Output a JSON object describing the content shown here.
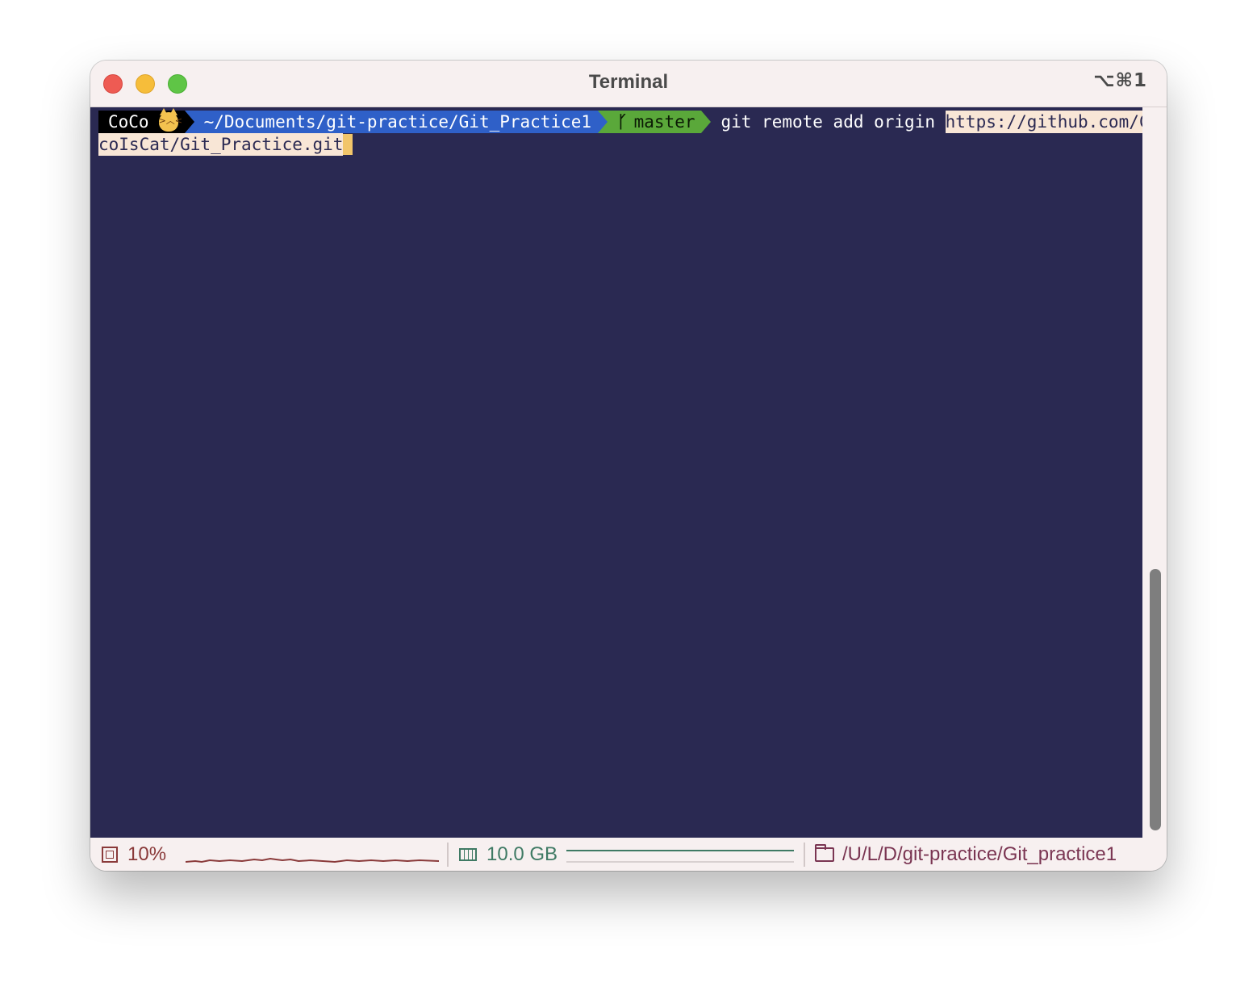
{
  "window": {
    "title": "Terminal",
    "shortcut": "⌥⌘1"
  },
  "prompt": {
    "user": "CoCo",
    "user_icon": "pouting-cat-icon",
    "path": "~/Documents/git-practice/Git_Practice1",
    "branch_icon": "git-branch-icon",
    "branch": "master"
  },
  "command": {
    "text": "git remote add origin ",
    "url_line1": "https://github.com/Co",
    "url_line2": "coIsCat/Git_Practice.git"
  },
  "status": {
    "cpu_value": "10%",
    "memory_value": "10.0 GB",
    "directory": "/U/L/D/git-practice/Git_practice1"
  },
  "colors": {
    "terminal_bg": "#2a2952",
    "path_segment": "#2f60c8",
    "git_segment": "#5aa83a",
    "highlight": "#f8e6d6",
    "cursor": "#f1c56a"
  }
}
